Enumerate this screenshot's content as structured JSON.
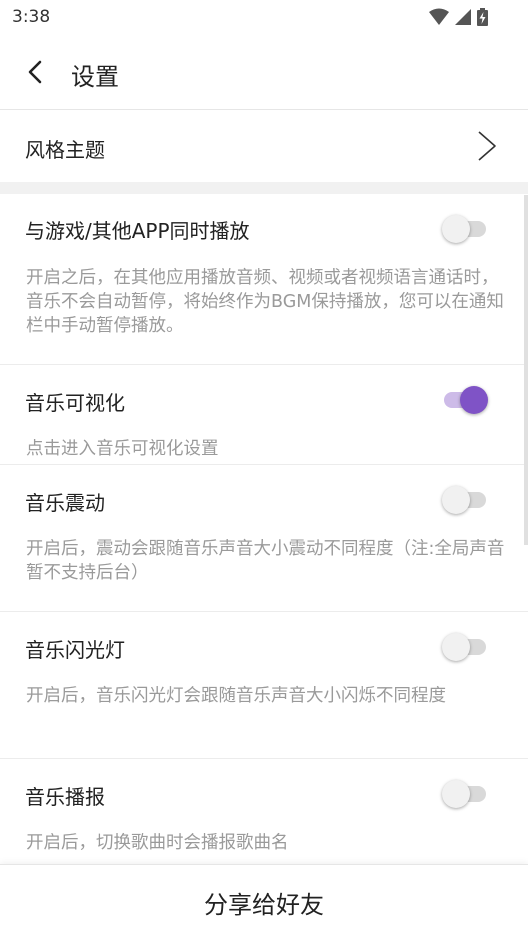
{
  "status_bar": {
    "time": "3:38"
  },
  "header": {
    "title": "设置"
  },
  "theme_row": {
    "label": "风格主题"
  },
  "settings": [
    {
      "title": "与游戏/其他APP同时播放",
      "description": "开启之后，在其他应用播放音频、视频或者视频语言通话时，音乐不会自动暂停，将始终作为BGM保持播放，您可以在通知栏中手动暂停播放。",
      "enabled": false
    },
    {
      "title": "音乐可视化",
      "description": "点击进入音乐可视化设置",
      "enabled": true
    },
    {
      "title": "音乐震动",
      "description": "开启后，震动会跟随音乐声音大小震动不同程度（注:全局声音暂不支持后台）",
      "enabled": false
    },
    {
      "title": "音乐闪光灯",
      "description": "开启后，音乐闪光灯会跟随音乐声音大小闪烁不同程度",
      "enabled": false
    },
    {
      "title": "音乐播报",
      "description": "开启后，切换歌曲时会播报歌曲名",
      "enabled": false
    }
  ],
  "share": {
    "label": "分享给好友"
  },
  "colors": {
    "accent": "#7f53c6",
    "accent_track": "#cdbbe8",
    "divider": "#ececec"
  }
}
